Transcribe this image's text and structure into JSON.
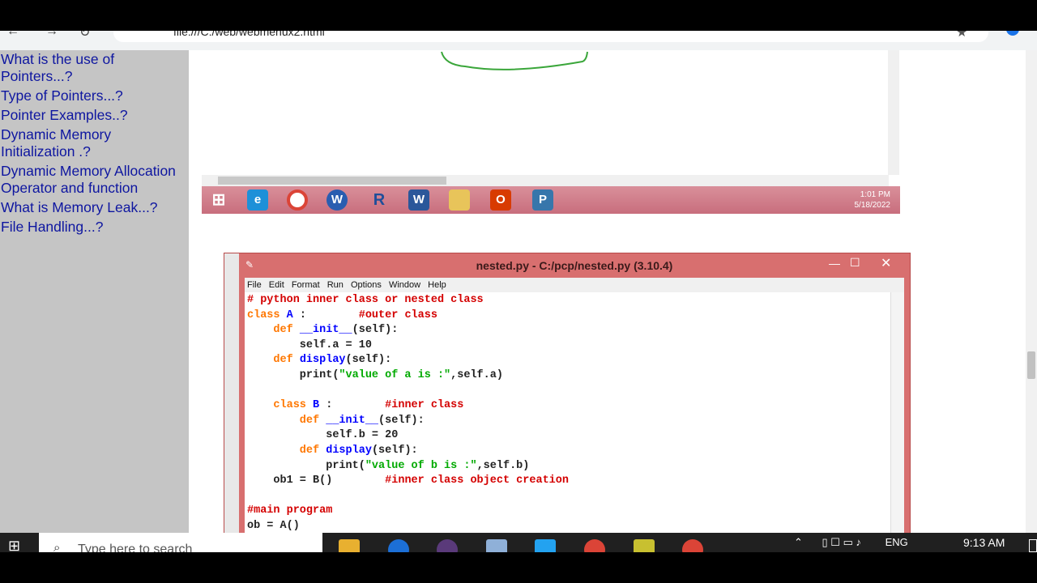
{
  "browser": {
    "url": "file:///C:/web/webmenux2.html"
  },
  "sidebar": {
    "links": [
      "What is the use of Pointers...?",
      "Type of Pointers...?",
      "Pointer Examples..?",
      "Dynamic Memory Initialization .?",
      "Dynamic Memory Allocation Operator and function",
      "What is Memory Leak...?",
      "File Handling...?"
    ]
  },
  "win7": {
    "time": "1:01 PM",
    "date": "5/18/2022",
    "apps": [
      "ie-icon",
      "chrome-icon",
      "app-icon",
      "r-icon",
      "word-icon",
      "explorer-icon",
      "office-icon",
      "python-icon"
    ]
  },
  "idle": {
    "title": "nested.py - C:/pcp/nested.py (3.10.4)",
    "menu": [
      "File",
      "Edit",
      "Format",
      "Run",
      "Options",
      "Window",
      "Help"
    ],
    "code": [
      [
        {
          "t": "# python inner class or nested class",
          "c": "c"
        }
      ],
      [
        {
          "t": "class ",
          "c": "k"
        },
        {
          "t": "A",
          "c": "f"
        },
        {
          "t": " :        ",
          "c": "p"
        },
        {
          "t": "#outer class",
          "c": "c"
        }
      ],
      [
        {
          "t": "    def ",
          "c": "k"
        },
        {
          "t": "__init__",
          "c": "f"
        },
        {
          "t": "(self):",
          "c": "p"
        }
      ],
      [
        {
          "t": "        self.a = 10",
          "c": "p"
        }
      ],
      [
        {
          "t": "    def ",
          "c": "k"
        },
        {
          "t": "display",
          "c": "f"
        },
        {
          "t": "(self):",
          "c": "p"
        }
      ],
      [
        {
          "t": "        print(",
          "c": "p"
        },
        {
          "t": "\"value of a is :\"",
          "c": "s"
        },
        {
          "t": ",self.a)",
          "c": "p"
        }
      ],
      [
        {
          "t": "",
          "c": "p"
        }
      ],
      [
        {
          "t": "    class ",
          "c": "k"
        },
        {
          "t": "B",
          "c": "f"
        },
        {
          "t": " :        ",
          "c": "p"
        },
        {
          "t": "#inner class",
          "c": "c"
        }
      ],
      [
        {
          "t": "        def ",
          "c": "k"
        },
        {
          "t": "__init__",
          "c": "f"
        },
        {
          "t": "(self):",
          "c": "p"
        }
      ],
      [
        {
          "t": "            self.b = 20",
          "c": "p"
        }
      ],
      [
        {
          "t": "        def ",
          "c": "k"
        },
        {
          "t": "display",
          "c": "f"
        },
        {
          "t": "(self):",
          "c": "p"
        }
      ],
      [
        {
          "t": "            print(",
          "c": "p"
        },
        {
          "t": "\"value of b is :\"",
          "c": "s"
        },
        {
          "t": ",self.b)",
          "c": "p"
        }
      ],
      [
        {
          "t": "    ob1 = B()        ",
          "c": "p"
        },
        {
          "t": "#inner class object creation",
          "c": "c"
        }
      ],
      [
        {
          "t": "",
          "c": "p"
        }
      ],
      [
        {
          "t": "#main program",
          "c": "c"
        }
      ],
      [
        {
          "t": "ob = A()",
          "c": "p"
        }
      ]
    ]
  },
  "taskbar": {
    "search_placeholder": "Type here to search",
    "lang": "ENG",
    "time": "9:13 AM"
  }
}
